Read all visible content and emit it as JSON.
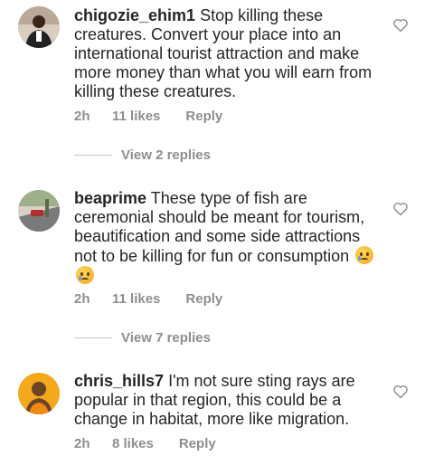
{
  "comments": [
    {
      "username": "chigozie_ehim1",
      "text": "Stop killing these creatures. Convert your place into an international tourist attraction and make more money than what you will earn from killing these creatures.",
      "time": "2h",
      "likes": "11 likes",
      "reply": "Reply",
      "view_replies": "View 2 replies",
      "avatar_colors": [
        "#3a2a22",
        "#c9b8a6"
      ]
    },
    {
      "username": "beaprime",
      "text": "These type of fish are ceremonial should be meant for tourism, beautification and some side attractions not to be killing for fun or consumption",
      "emoji_count": 2,
      "emoji": "crying-face",
      "time": "2h",
      "likes": "11 likes",
      "reply": "Reply",
      "view_replies": "View 7 replies",
      "avatar_colors": [
        "#8fa37c",
        "#d6d3c8"
      ]
    },
    {
      "username": "chris_hills7",
      "text": "I'm not sure sting rays are popular in that region, this could be a change in habitat, more like migration.",
      "time": "2h",
      "likes": "8 likes",
      "reply": "Reply",
      "avatar_colors": [
        "#f2a51a",
        "#5b3a1f"
      ]
    }
  ],
  "icons": {
    "like": "heart-outline-icon"
  }
}
